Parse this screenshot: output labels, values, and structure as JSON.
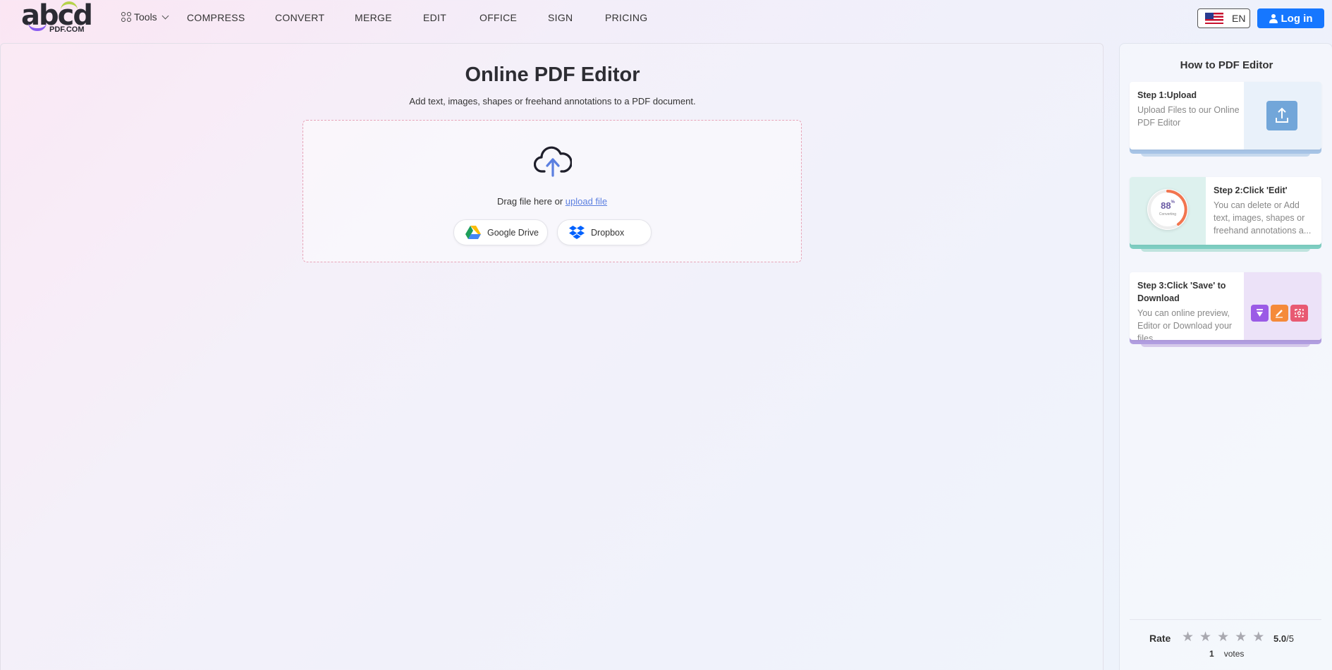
{
  "header": {
    "logo_text": "abcd",
    "logo_domain": "PDF.COM",
    "tools_label": "Tools",
    "nav": [
      "COMPRESS",
      "CONVERT",
      "MERGE",
      "EDIT",
      "OFFICE",
      "SIGN",
      "PRICING"
    ],
    "language": "EN",
    "login_label": "Log in",
    "accent_color": "#1677ff"
  },
  "main": {
    "title": "Online PDF Editor",
    "subtitle": "Add text, images, shapes or freehand annotations to a PDF document.",
    "drag_text": "Drag file here or",
    "upload_link": "upload file",
    "google_drive_label": "Google Drive",
    "dropbox_label": "Dropbox"
  },
  "sidebar": {
    "title": "How to PDF Editor",
    "steps": [
      {
        "title": "Step 1:Upload",
        "desc": "Upload Files to our Online PDF Editor"
      },
      {
        "title": "Step 2:Click 'Edit'",
        "desc": "You can delete or Add text, images, shapes or freehand annotations a...",
        "gauge_value": "88",
        "gauge_unit": "%",
        "gauge_caption": "Converting"
      },
      {
        "title": "Step 3:Click 'Save' to Download",
        "desc": "You can online preview, Editor or Download your files"
      }
    ],
    "rating": {
      "label": "Rate",
      "score": "5.0",
      "max": "/5",
      "votes_count": "1",
      "votes_label": "votes"
    }
  }
}
